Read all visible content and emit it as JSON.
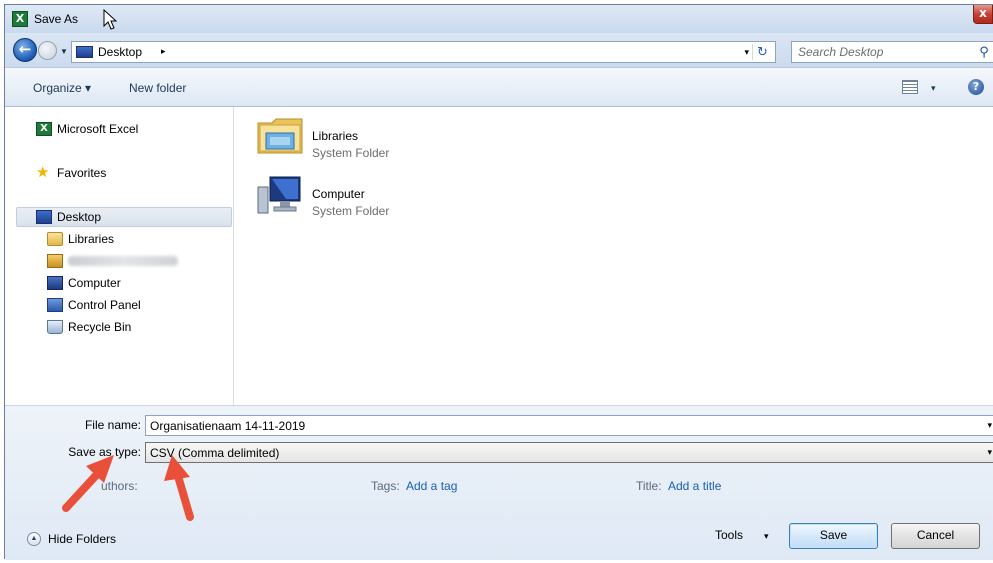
{
  "window": {
    "title": "Save As",
    "close_label": "x"
  },
  "address": {
    "location": "Desktop",
    "chevron": "▸",
    "dropdown": "▾",
    "refresh": "↻"
  },
  "search": {
    "placeholder": "Search Desktop",
    "icon": "search-icon"
  },
  "toolbar": {
    "organize_label": "Organize ▾",
    "new_folder_label": "New folder",
    "view_arrow": "▾",
    "help": "?"
  },
  "nav": {
    "items": [
      {
        "label": "Microsoft Excel",
        "icon": "excel-icon"
      },
      {
        "label": "Favorites",
        "icon": "star-icon"
      },
      {
        "label": "Desktop",
        "icon": "desktop-icon",
        "selected": true
      },
      {
        "label": "Libraries",
        "icon": "libraries-icon"
      },
      {
        "label": "",
        "icon": "user-folder-icon"
      },
      {
        "label": "Computer",
        "icon": "computer-icon"
      },
      {
        "label": "Control Panel",
        "icon": "control-panel-icon"
      },
      {
        "label": "Recycle Bin",
        "icon": "recycle-bin-icon"
      }
    ]
  },
  "content": {
    "items": [
      {
        "name": "Libraries",
        "type": "System Folder",
        "icon": "libraries-folder-icon"
      },
      {
        "name": "Computer",
        "type": "System Folder",
        "icon": "computer-icon"
      }
    ]
  },
  "form": {
    "file_name_label": "File name:",
    "file_name_value": "Organisatienaam 14-11-2019",
    "save_as_type_label": "Save as type:",
    "save_as_type_value": "CSV (Comma delimited)",
    "authors_label": "uthors:",
    "tags_label": "Tags:",
    "tags_link": "Add a tag",
    "title_label": "Title:",
    "title_link": "Add a title",
    "dropdown_arrow": "▾"
  },
  "footer": {
    "hide_folders_label": "Hide Folders",
    "hide_folders_icon": "▲",
    "tools_label": "Tools",
    "tools_arrow": "▾",
    "save_label": "Save",
    "cancel_label": "Cancel"
  },
  "colors": {
    "accent": "#1a5fb4",
    "annotation_arrow": "#e8503a"
  }
}
